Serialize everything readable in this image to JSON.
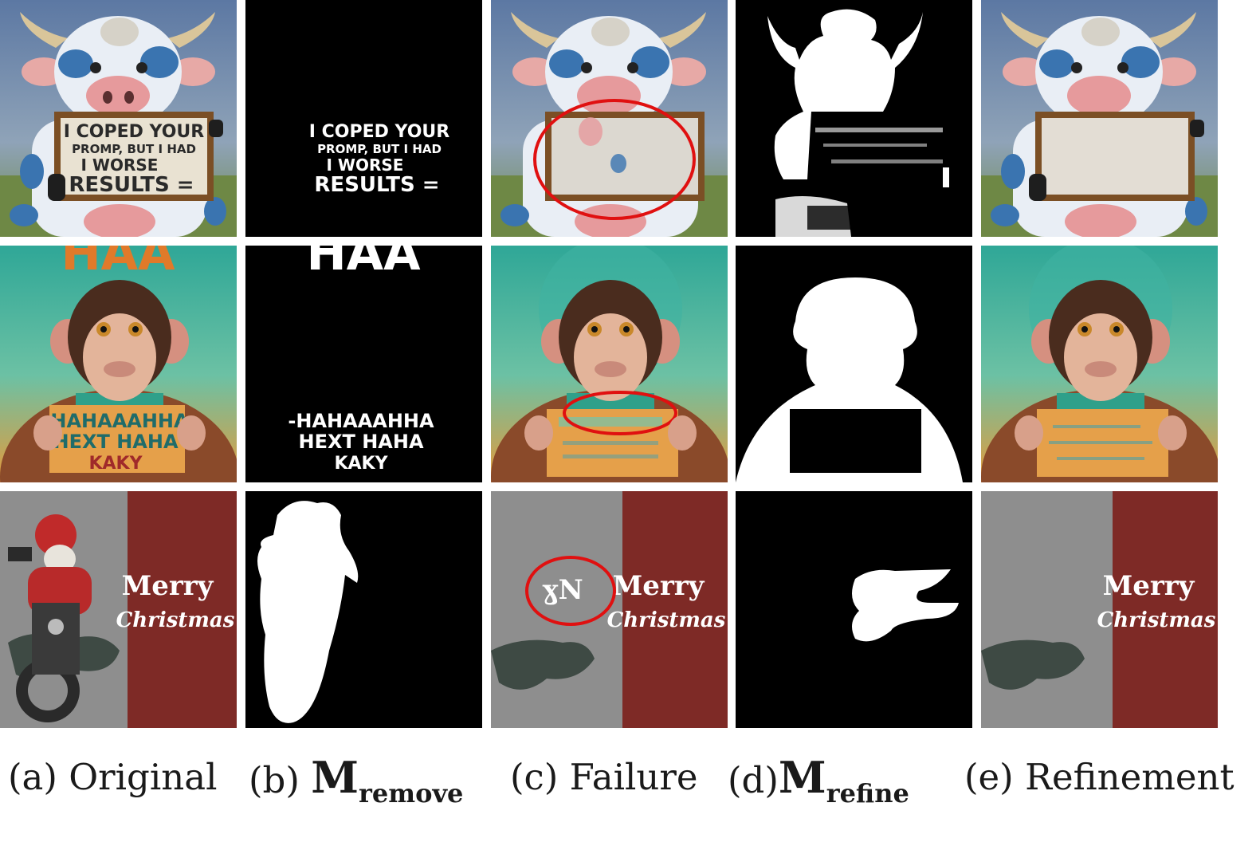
{
  "captions": {
    "a": {
      "prefix": "(a)",
      "label": "Original"
    },
    "b": {
      "prefix": "(b)",
      "symbol": "M",
      "subscript": "remove"
    },
    "c": {
      "prefix": "(c)",
      "label": "Failure"
    },
    "d": {
      "prefix": "(d)",
      "symbol": "M",
      "subscript": "refine"
    },
    "e": {
      "prefix": "(e)",
      "label": "Refinement"
    }
  },
  "row1": {
    "sign_lines": [
      "I COPED YOUR",
      "PROMP, BUT I HAD",
      "I WORSE",
      "RESULTS ="
    ]
  },
  "row2": {
    "top_text": "HAA",
    "sign_lines": [
      "-HAHAAAHHA",
      "HEXT HAHA",
      "KAKY"
    ]
  },
  "row3": {
    "merry": "Merry",
    "christmas": "Christmas",
    "failure_artifact": "ɣN"
  },
  "colors": {
    "sky": "#6f86a8",
    "grass": "#7c8e4a",
    "board": "#8a5a2a",
    "teal": "#3fae9c",
    "orange": "#e59a3a",
    "red_panel": "#7e2a26",
    "grey_bg": "#8e8e8e",
    "highlight": "#e01010"
  }
}
